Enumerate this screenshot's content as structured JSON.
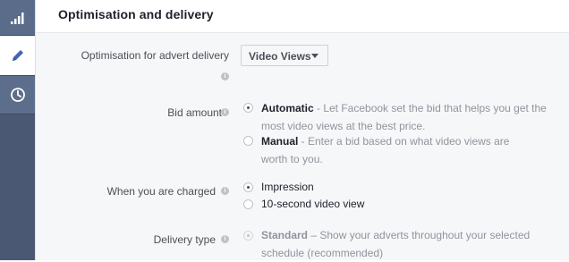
{
  "rail": {
    "items": [
      {
        "icon": "bar-chart-icon"
      },
      {
        "icon": "pencil-icon"
      },
      {
        "icon": "clock-icon"
      }
    ]
  },
  "panel": {
    "title": "Optimisation and delivery"
  },
  "optimisation": {
    "label": "Optimisation for advert delivery",
    "selected": "Video Views"
  },
  "bid": {
    "label": "Bid amount",
    "options": [
      {
        "title": "Automatic",
        "desc": " - Let Facebook set the bid that helps you get the most video views at the best price.",
        "selected": true
      },
      {
        "title": "Manual",
        "desc": " - Enter a bid based on what video views are worth to you.",
        "selected": false
      }
    ]
  },
  "charged": {
    "label": "When you are charged",
    "options": [
      {
        "title": "Impression",
        "selected": true
      },
      {
        "title": "10-second video view",
        "selected": false
      }
    ]
  },
  "delivery": {
    "label": "Delivery type",
    "options": [
      {
        "title": "Standard",
        "desc": " – Show your adverts throughout your selected schedule (recommended)",
        "selected": true
      }
    ]
  },
  "info_glyph": "i",
  "colors": {
    "rail": "#4a5873",
    "rail_active": "#ffffff",
    "accent": "#4267b2",
    "body_bg": "#f6f7f9"
  }
}
